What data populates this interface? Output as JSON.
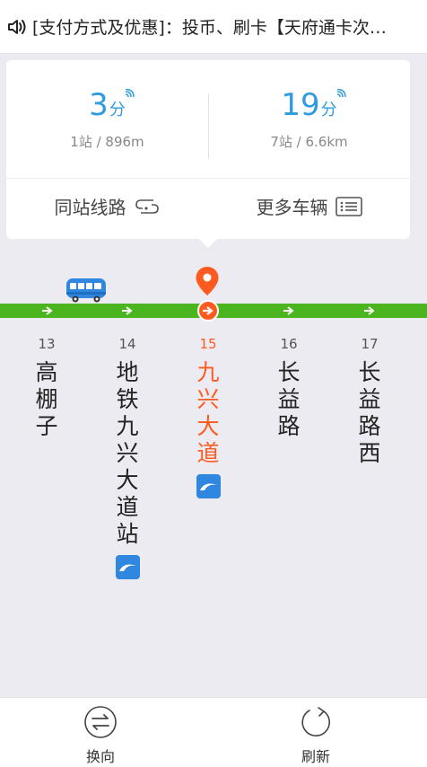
{
  "notice": {
    "text": "[支付方式及优惠]：投币、刷卡【天府通卡次…",
    "icon": "speaker-icon"
  },
  "eta": [
    {
      "minutes": "3",
      "unit": "分",
      "detail": "1站 / 896m"
    },
    {
      "minutes": "19",
      "unit": "分",
      "detail": "7站 / 6.6km"
    }
  ],
  "actions": {
    "same_station": "同站线路",
    "more_vehicles": "更多车辆"
  },
  "stops": [
    {
      "number": "13",
      "name": "高\n棚\n子",
      "metro": false
    },
    {
      "number": "14",
      "name": "地\n铁\n九\n兴\n大\n道\n站",
      "metro": true
    },
    {
      "number": "15",
      "name": "九\n兴\n大\n道",
      "metro": true,
      "current": true
    },
    {
      "number": "16",
      "name": "长\n益\n路",
      "metro": false
    },
    {
      "number": "17",
      "name": "长\n益\n路\n西",
      "metro": false
    }
  ],
  "bottom": {
    "reverse_label": "换向",
    "refresh_label": "刷新"
  },
  "colors": {
    "accent": "#2F9BE0",
    "track": "#4BB51F",
    "current": "#FF5A1F",
    "metro": "#2F87E0"
  }
}
